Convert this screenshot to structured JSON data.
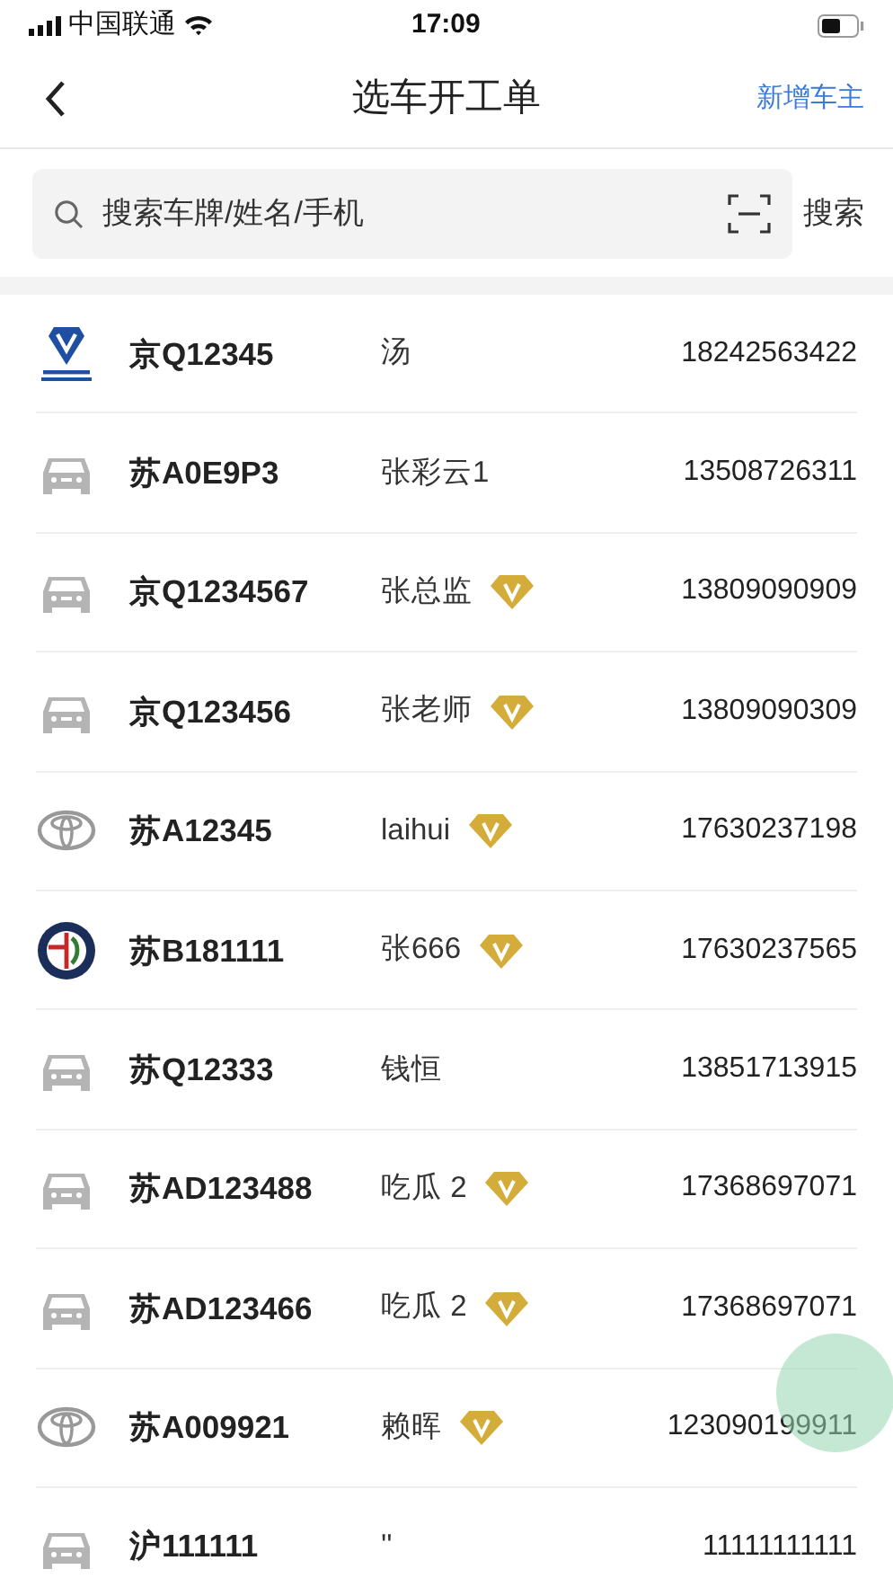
{
  "status_bar": {
    "carrier": "中国联通",
    "time": "17:09"
  },
  "nav": {
    "title": "选车开工单",
    "action": "新增车主"
  },
  "search": {
    "placeholder": "搜索车牌/姓名/手机",
    "button": "搜索"
  },
  "rows": [
    {
      "kind": "changan",
      "plate": "京Q12345",
      "name": "汤",
      "vip": false,
      "phone": "18242563422"
    },
    {
      "kind": "generic",
      "plate": "苏A0E9P3",
      "name": "张彩云1",
      "vip": false,
      "phone": "13508726311"
    },
    {
      "kind": "generic",
      "plate": "京Q1234567",
      "name": "张总监",
      "vip": true,
      "phone": "13809090909"
    },
    {
      "kind": "generic",
      "plate": "京Q123456",
      "name": "张老师",
      "vip": true,
      "phone": "13809090309"
    },
    {
      "kind": "toyota",
      "plate": "苏A12345",
      "name": "laihui",
      "vip": true,
      "phone": "17630237198"
    },
    {
      "kind": "alfa",
      "plate": "苏B181111",
      "name": "张666",
      "vip": true,
      "phone": "17630237565"
    },
    {
      "kind": "generic",
      "plate": "苏Q12333",
      "name": "钱恒",
      "vip": false,
      "phone": "13851713915"
    },
    {
      "kind": "generic",
      "plate": "苏AD123488",
      "name": "吃瓜 2",
      "vip": true,
      "phone": "17368697071"
    },
    {
      "kind": "generic",
      "plate": "苏AD123466",
      "name": "吃瓜 2",
      "vip": true,
      "phone": "17368697071"
    },
    {
      "kind": "toyota",
      "plate": "苏A009921",
      "name": "赖晖",
      "vip": true,
      "phone": "123090199911"
    },
    {
      "kind": "generic",
      "plate": "沪111111",
      "name": "''",
      "vip": false,
      "phone": "11111111111"
    }
  ]
}
